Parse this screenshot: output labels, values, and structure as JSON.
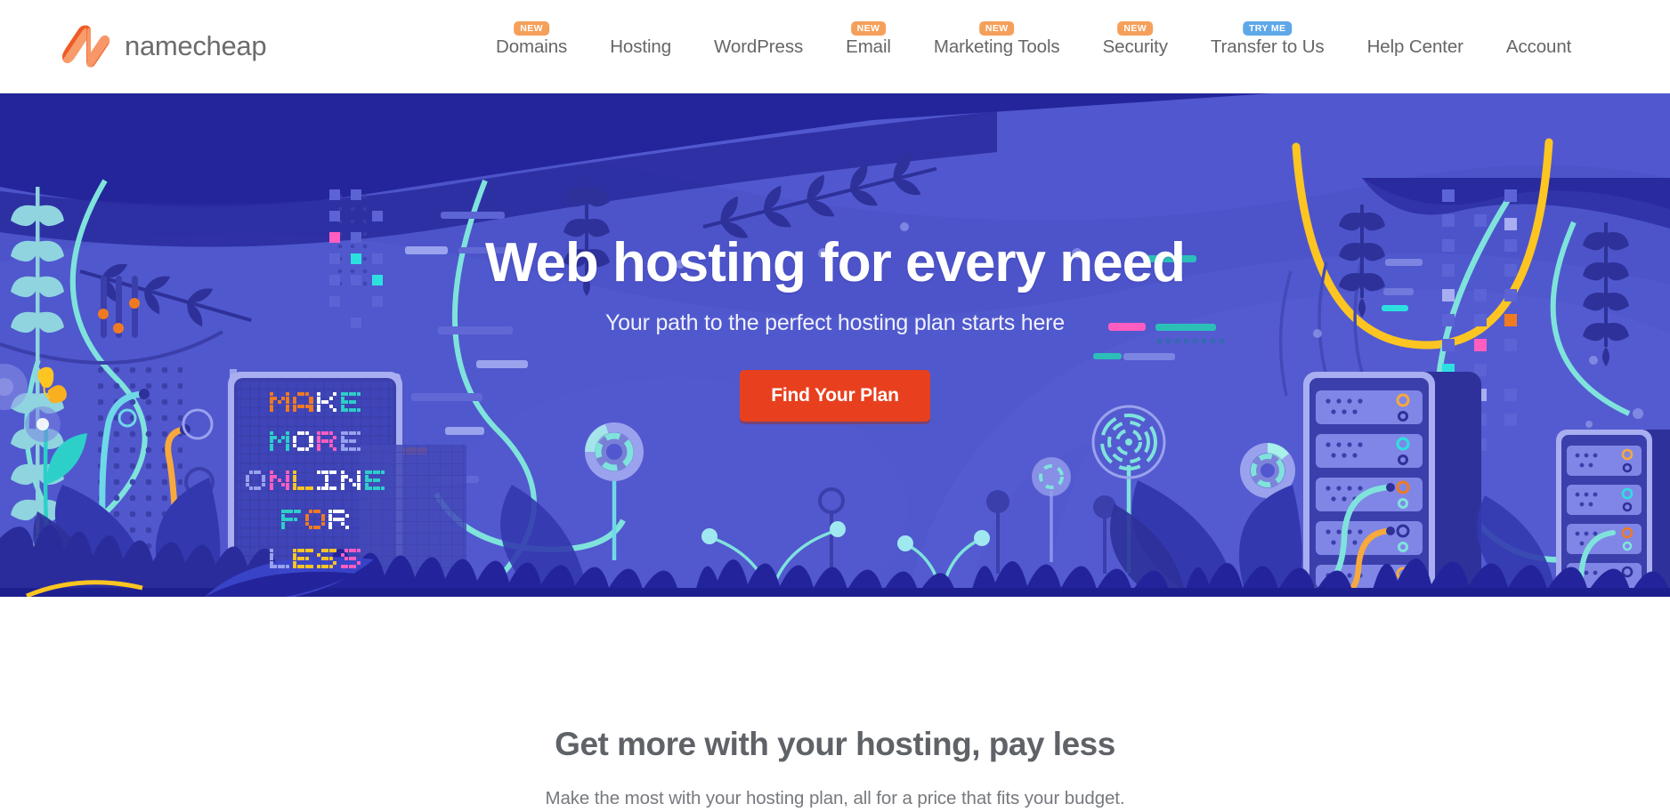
{
  "brand": {
    "name": "namecheap",
    "logo_icon": "namecheap-logo-icon",
    "logo_color_dark": "#ef5b25",
    "logo_color_light": "#f89c6c"
  },
  "nav": {
    "items": [
      {
        "label": "Domains",
        "badge": "NEW",
        "badge_type": "new"
      },
      {
        "label": "Hosting",
        "badge": null,
        "badge_type": null
      },
      {
        "label": "WordPress",
        "badge": null,
        "badge_type": null
      },
      {
        "label": "Email",
        "badge": "NEW",
        "badge_type": "new"
      },
      {
        "label": "Marketing Tools",
        "badge": "NEW",
        "badge_type": "new"
      },
      {
        "label": "Security",
        "badge": "NEW",
        "badge_type": "new"
      },
      {
        "label": "Transfer to Us",
        "badge": "TRY ME",
        "badge_type": "try"
      },
      {
        "label": "Help Center",
        "badge": null,
        "badge_type": null
      },
      {
        "label": "Account",
        "badge": null,
        "badge_type": null
      }
    ],
    "badge_new_color": "#f5a05a",
    "badge_try_color": "#5fa8e8",
    "text_color": "#666666"
  },
  "hero": {
    "title": "Web hosting for every need",
    "subtitle": "Your path to the perfect hosting plan starts here",
    "cta_label": "Find Your Plan",
    "cta_color": "#e8401f",
    "background_color": "#4d54ca",
    "ground_color": "#1e1f8f",
    "sign_lines": [
      "MAKE",
      "MORE",
      "ONLINE",
      "FOR",
      "LESS"
    ],
    "accent_teal": "#7fe3dc",
    "accent_yellow": "#fcc522",
    "accent_pink": "#ff5ec0",
    "accent_orange": "#f07a22"
  },
  "section": {
    "title": "Get more with your hosting, pay less",
    "subtitle": "Make the most with your hosting plan, all for a price that fits your budget.",
    "title_color": "#5f6368"
  }
}
